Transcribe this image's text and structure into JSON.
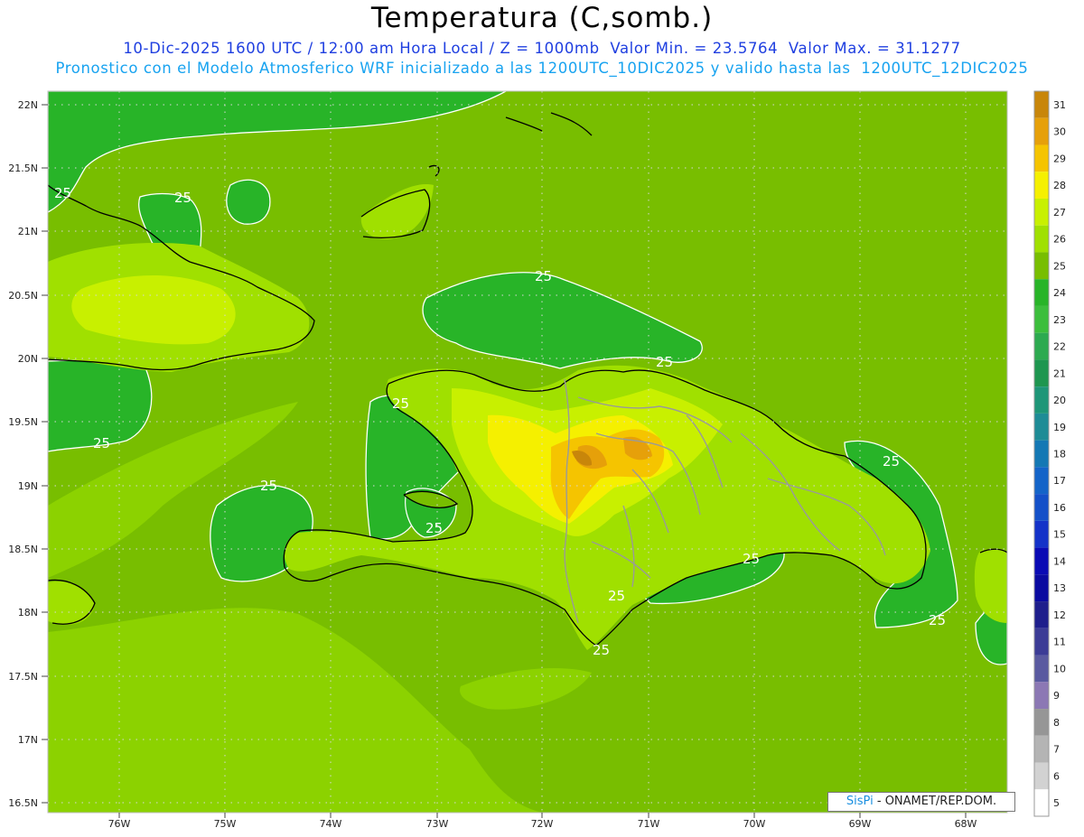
{
  "title": "Temperatura (C,somb.)",
  "subtitle_line1": "10-Dic-2025 1600 UTC / 12:00 am Hora Local / Z = 1000mb  Valor Min. = 23.5764  Valor Max. = 31.1277",
  "subtitle_line2": "Pronostico con el Modelo Atmosferico WRF inicializado a las 1200UTC_10DIC2025 y valido hasta las  1200UTC_12DIC2025",
  "credit": {
    "brand": "SisPi",
    "text": " - ONAMET/REP.DOM."
  },
  "lat_labels": [
    "22N",
    "21.5N",
    "21N",
    "20.5N",
    "20N",
    "19.5N",
    "19N",
    "18.5N",
    "18N",
    "17.5N",
    "17N",
    "16.5N"
  ],
  "lon_labels": [
    "76W",
    "75W",
    "74W",
    "73W",
    "72W",
    "71W",
    "70W",
    "69W",
    "68W"
  ],
  "contour_labels": [
    "25",
    "25",
    "25",
    "25",
    "25",
    "25",
    "25",
    "25",
    "25",
    "25",
    "25",
    "25",
    "25"
  ],
  "colorbar": {
    "levels": [
      31,
      30,
      29,
      28,
      27,
      26,
      25,
      24,
      23,
      22,
      21,
      20,
      19,
      18,
      17,
      16,
      15,
      14,
      13,
      12,
      11,
      10,
      9,
      8,
      7,
      6,
      5
    ],
    "colors": [
      "#c8860a",
      "#e6a00a",
      "#f5c400",
      "#f5f000",
      "#c8f000",
      "#a0e000",
      "#78be00",
      "#28b428",
      "#3cbe3c",
      "#2daa50",
      "#1e9650",
      "#1e9678",
      "#1e8c96",
      "#1478b4",
      "#1464c8",
      "#1450c8",
      "#1432c8",
      "#0a0ab4",
      "#0a0aa0",
      "#1e1e8c",
      "#3c3c96",
      "#5a5aa0",
      "#8c78b4",
      "#969696",
      "#b4b4b4",
      "#d2d2d2",
      "#ffffff"
    ]
  },
  "colors": {
    "sea_base": "#78be00",
    "sea_warm": "#8cd200",
    "cool_zone": "#28b428",
    "land_mid": "#a0e000",
    "land_warm": "#c8f000",
    "land_hot": "#f5f000",
    "land_hotter": "#f5c400",
    "land_hottest": "#e6a00a",
    "peak": "#c8860a"
  }
}
